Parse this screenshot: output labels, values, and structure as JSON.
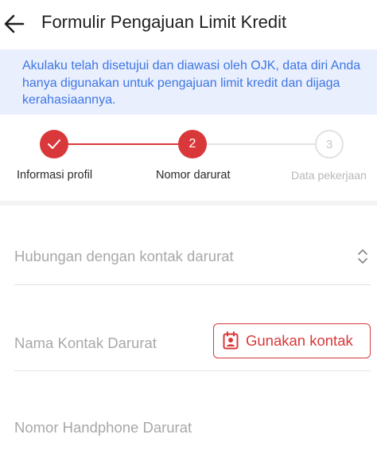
{
  "header": {
    "title": "Formulir Pengajuan Limit Kredit"
  },
  "notice": {
    "text": "Akulaku telah disetujui dan diawasi oleh OJK, data diri Anda hanya digunakan untuk pengajuan limit kredit dan dijaga kerahasiaannya."
  },
  "stepper": {
    "steps": [
      {
        "label": "Informasi profil",
        "number": "1",
        "status": "completed"
      },
      {
        "label": "Nomor darurat",
        "number": "2",
        "status": "current"
      },
      {
        "label": "Data pekerjaan",
        "number": "3",
        "status": "pending"
      }
    ]
  },
  "form": {
    "relationship_placeholder": "Hubungan dengan kontak darurat",
    "contact_name_placeholder": "Nama Kontak Darurat",
    "use_contact_label": "Gunakan kontak",
    "phone_placeholder": "Nomor Handphone Darurat"
  },
  "colors": {
    "accent": "#d9383a",
    "notice_bg": "#e9effd",
    "notice_text": "#3f76e4",
    "placeholder": "#a8a8a8"
  },
  "icons": {
    "back": "arrow-left-icon",
    "check": "check-icon",
    "select": "chevron-up-down-icon",
    "contact": "contact-book-icon"
  }
}
